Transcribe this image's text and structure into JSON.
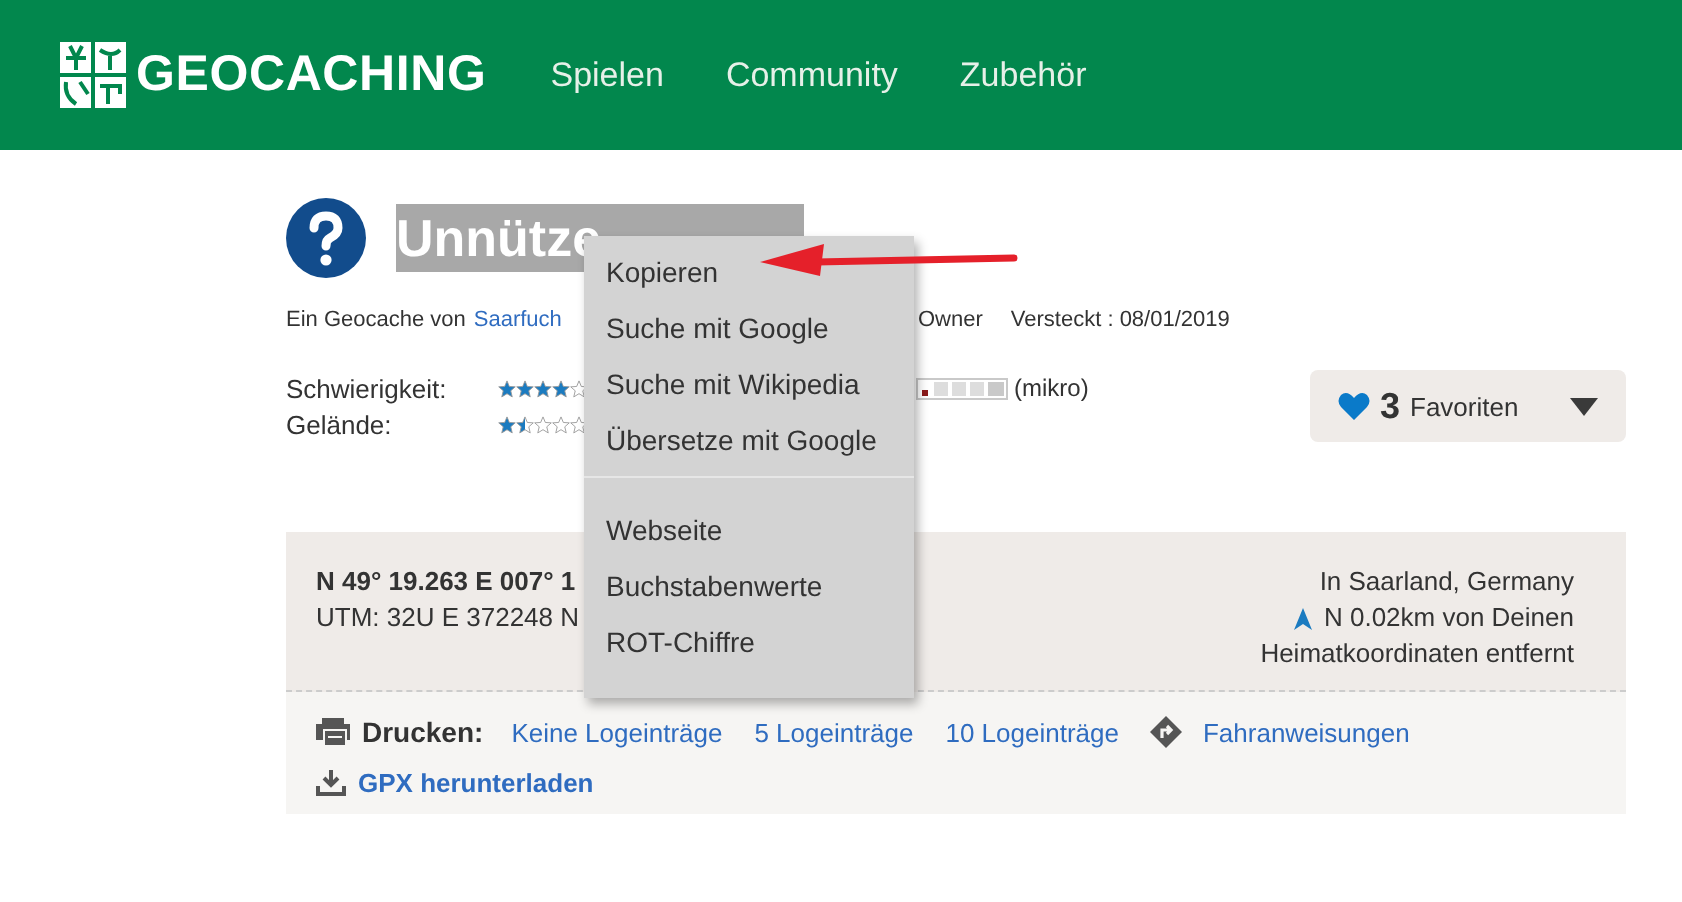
{
  "header": {
    "logo": "GEOCACHING",
    "nav": [
      {
        "label": "Spielen"
      },
      {
        "label": "Community"
      },
      {
        "label": "Zubehör"
      }
    ]
  },
  "cache": {
    "title": "Unnütze",
    "owner_prefix": "Ein Geocache von",
    "owner_link": "Saarfuch",
    "owner_role": "Owner",
    "hidden": "Versteckt : 08/01/2019",
    "ratings": [
      {
        "label": "Schwierigkeit:",
        "stars": 4
      },
      {
        "label": "Gelände:",
        "stars": 1.5
      }
    ],
    "size": "(mikro)",
    "favorites": {
      "count": "3",
      "label": "Favoriten"
    }
  },
  "location": {
    "coords": "N 49° 19.263 E 007° 1",
    "utm": "UTM: 32U E 372248 N",
    "region": "In Saarland, Germany",
    "distance": "N 0.02km von Deinen",
    "distance_2": "Heimatkoordinaten entfernt"
  },
  "print": {
    "label": "Drucken:",
    "links": [
      {
        "label": "Keine Logeinträge"
      },
      {
        "label": "5 Logeinträge"
      },
      {
        "label": "10 Logeinträge"
      }
    ],
    "directions": "Fahranweisungen",
    "gpx": "GPX herunterladen"
  },
  "context_menu": {
    "items": [
      {
        "label": "Kopieren",
        "kind": "item"
      },
      {
        "label": "Suche mit Google",
        "kind": "item"
      },
      {
        "label": "Suche mit Wikipedia",
        "kind": "item"
      },
      {
        "label": "Übersetze mit Google",
        "kind": "item"
      },
      {
        "kind": "separator"
      },
      {
        "label": "Webseite",
        "kind": "item"
      },
      {
        "label": "Buchstabenwerte",
        "kind": "item"
      },
      {
        "label": "ROT-Chiffre",
        "kind": "item"
      }
    ]
  }
}
